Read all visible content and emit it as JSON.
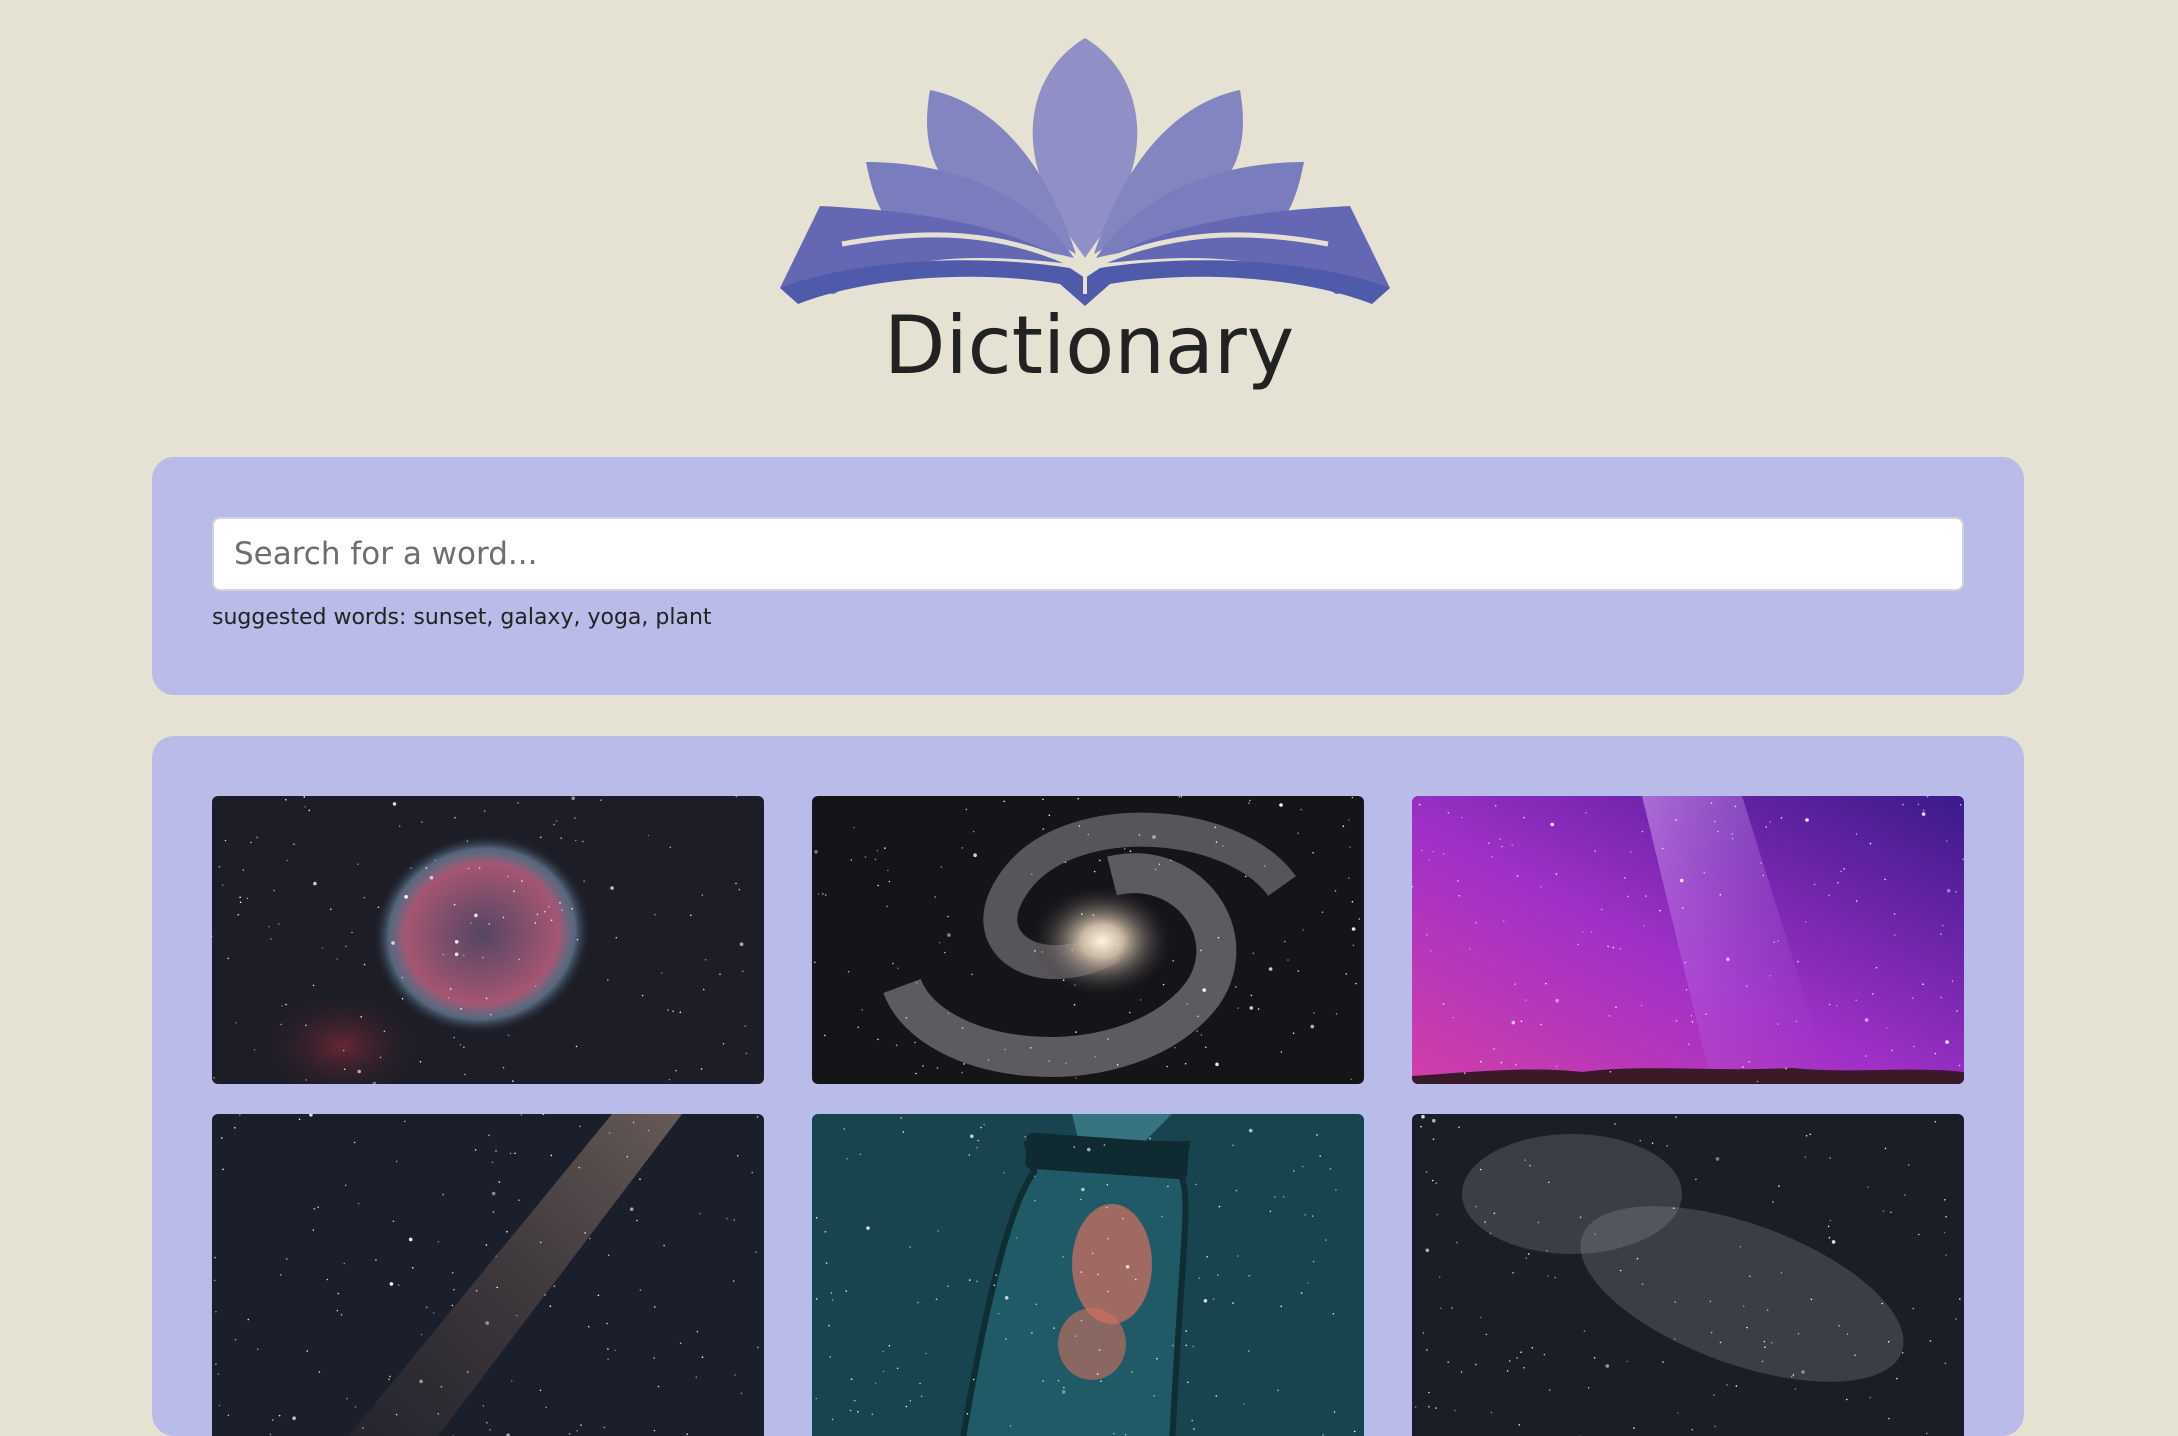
{
  "header": {
    "logo_icon": "lotus-book-icon",
    "title": "Dictionary"
  },
  "search": {
    "placeholder": "Search for a word...",
    "value": "",
    "suggested_prefix": "suggested words:",
    "suggested_words": [
      "sunset",
      "galaxy",
      "yoga",
      "plant"
    ]
  },
  "gallery": {
    "images": [
      {
        "subject": "crescent nebula in starfield"
      },
      {
        "subject": "barred spiral galaxy"
      },
      {
        "subject": "purple milky way over hills"
      },
      {
        "subject": "milky way band in dark sky"
      },
      {
        "subject": "hand holding jar of stars"
      },
      {
        "subject": "dark starry sky with milky way"
      }
    ]
  },
  "colors": {
    "background": "#e5e2d4",
    "panel": "#b9bbe8",
    "logo_dark": "#4f5aab",
    "logo_mid": "#7a7dbd",
    "logo_light": "#9190c6",
    "title_text": "#222222"
  }
}
